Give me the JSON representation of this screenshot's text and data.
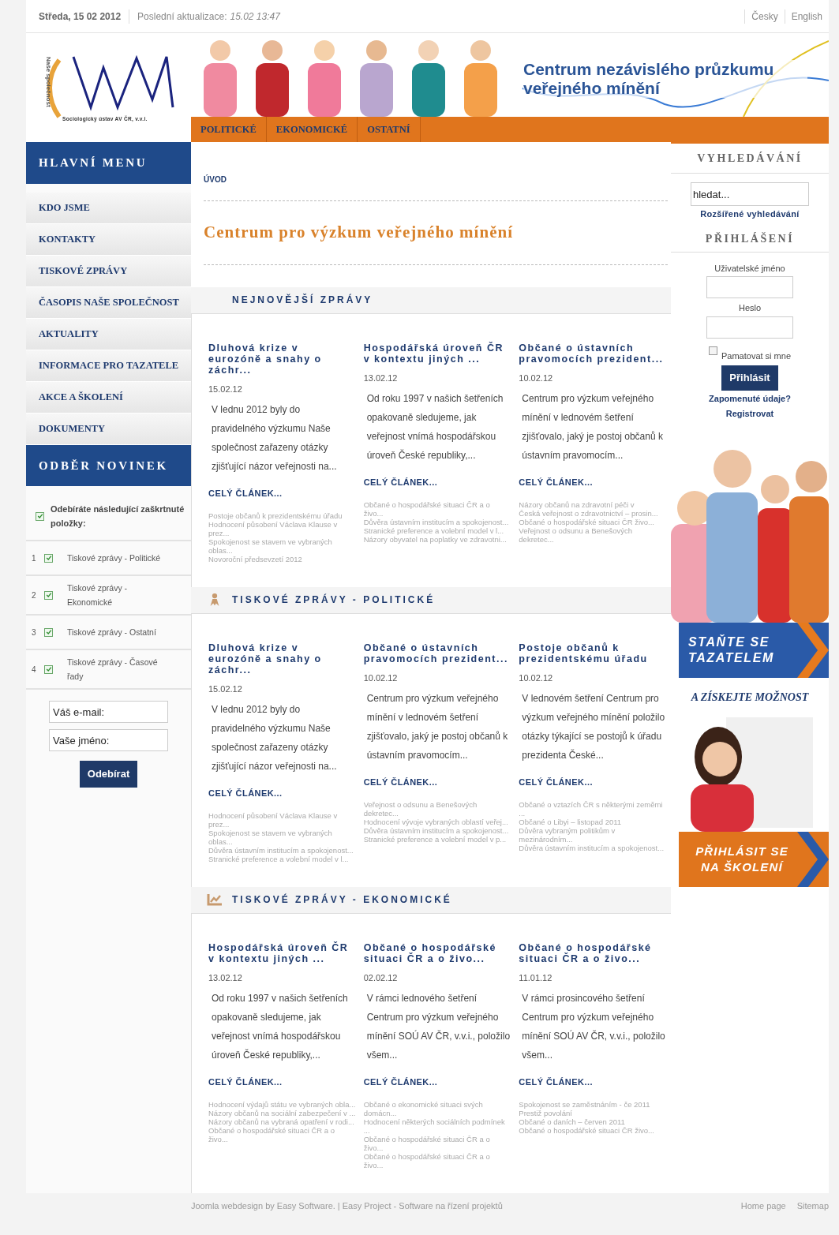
{
  "top_bar": {
    "date": "Středa, 15 02 2012",
    "update_label": "Poslední aktualizace:",
    "update_value": "15.02 13:47",
    "languages": [
      "Česky",
      "English"
    ]
  },
  "header": {
    "logo_vertical": "Naše společnost",
    "logo_caption": "Sociologický ústav AV ČR, v.v.i.",
    "banner_title": "Centrum nezávislého průzkumu veřejného mínění",
    "nav": [
      "POLITICKÉ",
      "EKONOMICKÉ",
      "OSTATNÍ"
    ]
  },
  "main_menu": {
    "title": "HLAVNÍ MENU",
    "items": [
      "KDO JSME",
      "KONTAKTY",
      "TISKOVÉ ZPRÁVY",
      "ČASOPIS NAŠE SPOLEČNOST",
      "AKTUALITY",
      "INFORMACE PRO TAZATELE",
      "AKCE A ŠKOLENÍ",
      "DOKUMENTY"
    ]
  },
  "newsletter": {
    "title": "ODBĚR NOVINEK",
    "all_label": "Odebíráte následující zaškrtnuté položky:",
    "all_checked": true,
    "items": [
      {
        "number": "1",
        "label": "Tiskové zprávy - Politické",
        "checked": true
      },
      {
        "number": "2",
        "label": "Tiskové zprávy - Ekonomické",
        "checked": true
      },
      {
        "number": "3",
        "label": "Tiskové zprávy - Ostatní",
        "checked": true
      },
      {
        "number": "4",
        "label": "Tiskové zprávy - Časové řady",
        "checked": true
      }
    ],
    "email_placeholder": "Váš e-mail:",
    "name_placeholder": "Vaše jméno:",
    "button": "Odebírat"
  },
  "content": {
    "breadcrumb": "ÚVOD",
    "page_title": "Centrum pro výzkum veřejného mínění",
    "sections": [
      {
        "title": "NEJNOVĚJŠÍ ZPRÁVY",
        "kind": "plain",
        "articles": [
          {
            "title": "Dluhová krize v eurozóně a snahy o záchr...",
            "date": "15.02.12",
            "intro": "V lednu 2012 byly do pravidelného výzkumu Naše společnost zařazeny otázky zjišťující názor veřejnosti na...",
            "more": "CELÝ ČLÁNEK...",
            "related": [
              "Postoje občanů k prezidentskému úřadu",
              "Hodnocení působení Václava Klause v prez...",
              "Spokojenost se stavem ve vybraných oblas...",
              "Novoroční předsevzetí 2012"
            ]
          },
          {
            "title": "Hospodářská úroveň ČR v kontextu jiných ...",
            "date": "13.02.12",
            "intro": "Od roku 1997 v našich šetřeních opakovaně sledujeme, jak veřejnost vnímá hospodářskou úroveň České republiky,...",
            "more": "CELÝ ČLÁNEK...",
            "related": [
              "Občané o hospodářské situaci ČR a o živo...",
              "Důvěra ústavním institucím a spokojenost...",
              "Stranické preference a volební model v l...",
              "Názory obyvatel na poplatky ve zdravotni..."
            ]
          },
          {
            "title": "Občané o ústavních pravomocích prezident...",
            "date": "10.02.12",
            "intro": "Centrum pro výzkum veřejného mínění v lednovém šetření zjišťovalo, jaký je postoj občanů k ústavním pravomocím...",
            "more": "CELÝ ČLÁNEK...",
            "related": [
              "Názory občanů na zdravotní péči v",
              "Česká veřejnost o zdravotnictví – prosin...",
              "Občané o hospodářské situaci ČR živo...",
              "Veřejnost o odsunu a Benešových dekretec..."
            ]
          }
        ]
      },
      {
        "title": "TISKOVÉ ZPRÁVY - POLITICKÉ",
        "kind": "people",
        "articles": [
          {
            "title": "Dluhová krize v eurozóně a snahy o záchr...",
            "date": "15.02.12",
            "intro": "V lednu 2012 byly do pravidelného výzkumu Naše společnost zařazeny otázky zjišťující názor veřejnosti na...",
            "more": "CELÝ ČLÁNEK...",
            "related": [
              "Hodnocení působení Václava Klause v prez...",
              "Spokojenost se stavem ve vybraných oblas...",
              "Důvěra ústavním institucím a spokojenost...",
              "Stranické preference a volební model v l..."
            ]
          },
          {
            "title": "Občané o ústavních pravomocích prezident...",
            "date": "10.02.12",
            "intro": "Centrum pro výzkum veřejného mínění v lednovém šetření zjišťovalo, jaký je postoj občanů k ústavním pravomocím...",
            "more": "CELÝ ČLÁNEK...",
            "related": [
              "Veřejnost o odsunu a Benešových dekretec...",
              "Hodnocení vývoje vybraných oblastí veřej...",
              "Důvěra ústavním institucím a spokojenost...",
              "Stranické preference a volební model v p..."
            ]
          },
          {
            "title": "Postoje občanů k prezidentskému úřadu",
            "date": "10.02.12",
            "intro": "V lednovém šetření Centrum pro výzkum veřejného mínění položilo otázky týkající se postojů k úřadu prezidenta České...",
            "more": "CELÝ ČLÁNEK...",
            "related": [
              "Občané o vztazích ČR s některými zeměmi ...",
              "Občané o Libyi – listopad 2011",
              "Důvěra vybraným politikům v mezinárodním...",
              "Důvěra ústavním institucím a spokojenost..."
            ]
          }
        ]
      },
      {
        "title": "TISKOVÉ ZPRÁVY - EKONOMICKÉ",
        "kind": "chart",
        "articles": [
          {
            "title": "Hospodářská úroveň ČR v kontextu jiných ...",
            "date": "13.02.12",
            "intro": "Od roku 1997 v našich šetřeních opakovaně sledujeme, jak veřejnost vnímá hospodářskou úroveň České republiky,...",
            "more": "CELÝ ČLÁNEK...",
            "related": [
              "Hodnocení výdajů státu ve vybraných obla...",
              "Názory občanů na sociální zabezpečení v ...",
              "Názory občanů na vybraná opatření v rodi...",
              "Občané o hospodářské situaci ČR a o živo..."
            ]
          },
          {
            "title": "Občané o hospodářské situaci ČR a o živo...",
            "date": "02.02.12",
            "intro": "V rámci lednového šetření Centrum pro výzkum veřejného mínění SOÚ AV ČR, v.v.i., položilo všem...",
            "more": "CELÝ ČLÁNEK...",
            "related": [
              "Občané o ekonomické situaci svých domácn...",
              "Hodnocení některých sociálních podmínek ...",
              "Občané o hospodářské situaci ČR a o živo...",
              "Občané o hospodářské situaci ČR a o živo..."
            ]
          },
          {
            "title": "Občané o hospodářské situaci ČR a o živo...",
            "date": "11.01.12",
            "intro": "V rámci prosincového šetření Centrum pro výzkum veřejného mínění SOÚ AV ČR, v.v.i., položilo všem...",
            "more": "CELÝ ČLÁNEK...",
            "related": [
              "Spokojenost se zaměstnáním - če 2011",
              "Prestiž povolání",
              "Občané o daních – červen 2011",
              "Občané o hospodářské situaci ČR živo..."
            ]
          }
        ]
      }
    ]
  },
  "search": {
    "title": "VYHLEDÁVÁNÍ",
    "placeholder": "hledat...",
    "advanced_link": "Rozšířené vyhledávání"
  },
  "login": {
    "title": "PŘIHLÁŠENÍ",
    "username_label": "Uživatelské jméno",
    "password_label": "Heslo",
    "remember_label": "Pamatovat si mne",
    "remember_checked": false,
    "button": "Přihlásit",
    "links": [
      "Zapomenuté údaje?",
      "Registrovat"
    ]
  },
  "promo": {
    "banner_1": "STAŇTE SE TAZATELEM",
    "tagline": "A ZÍSKEJTE MOŽNOST",
    "banner_2": "PŘIHLÁSIT SE NA ŠKOLENÍ"
  },
  "footer": {
    "credit": "Joomla webdesign by Easy Software. | Easy Project - Software na řízení projektů",
    "links": [
      "Home page",
      "Sitemap"
    ]
  }
}
